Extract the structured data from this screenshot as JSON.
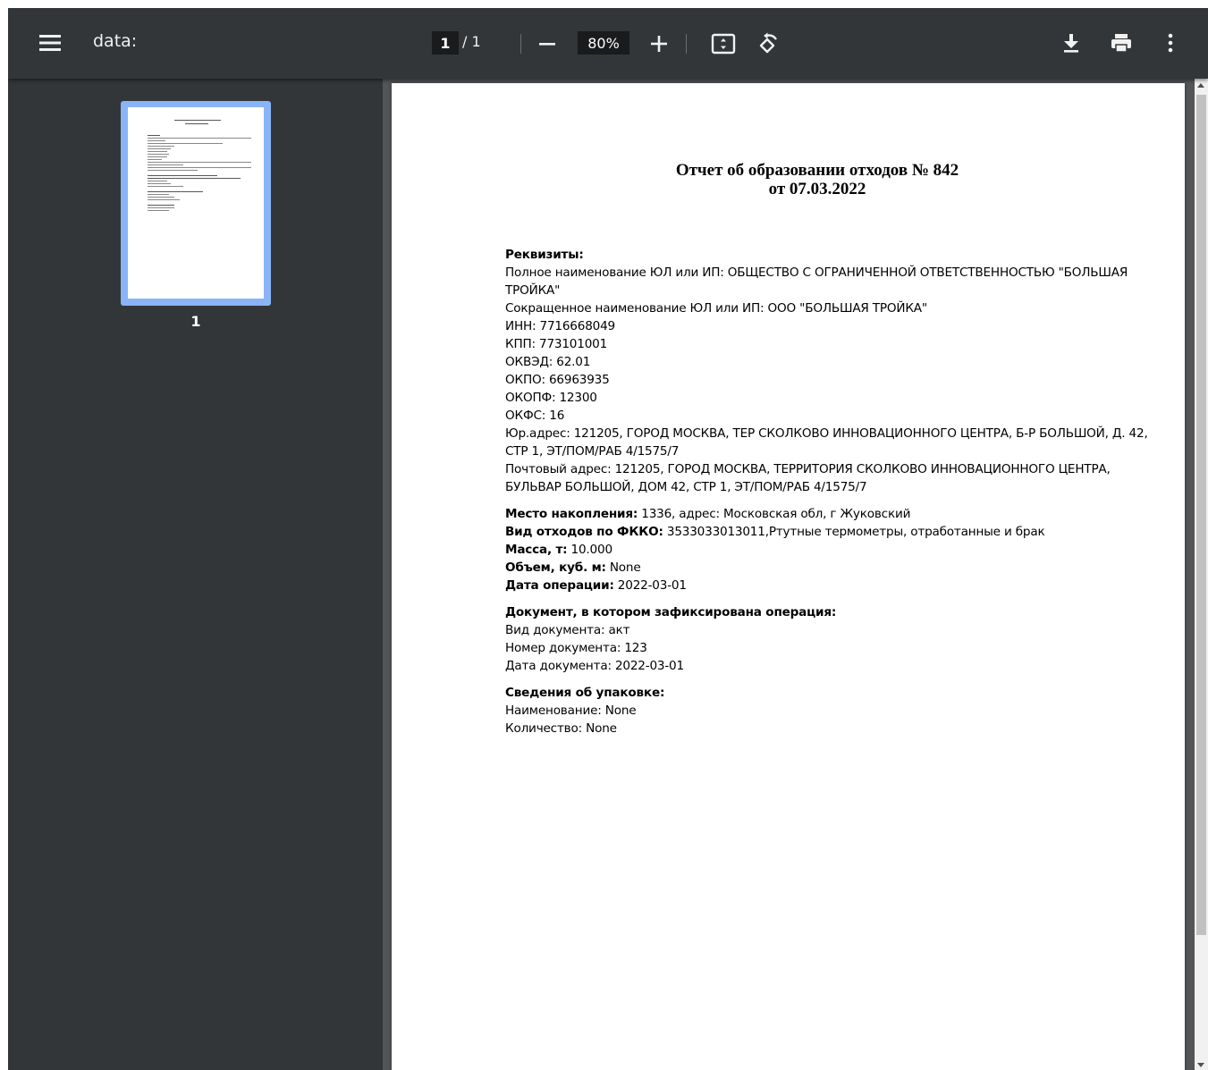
{
  "toolbar": {
    "title": "data:",
    "current_page": "1",
    "page_separator": "/",
    "total_pages": "1",
    "zoom": "80%",
    "icons": {
      "menu": "menu-icon",
      "zoom_out": "minus-icon",
      "zoom_in": "plus-icon",
      "fit": "fit-to-page-icon",
      "rotate": "rotate-icon",
      "download": "download-icon",
      "print": "print-icon",
      "more": "more-vert-icon"
    }
  },
  "sidebar": {
    "thumbnails": [
      {
        "label": "1",
        "selected": true
      }
    ],
    "selected_color": "#8ab4f8"
  },
  "document": {
    "title_line1": "Отчет об образовании отходов № 842",
    "title_line2": "от 07.03.2022",
    "requisites": {
      "heading": "Реквизиты:",
      "full_name": "Полное наименование ЮЛ или ИП: ОБЩЕСТВО С ОГРАНИЧЕННОЙ ОТВЕТСТВЕННОСТЬЮ \"БОЛЬШАЯ ТРОЙКА\"",
      "short_name": "Сокращенное наименование ЮЛ или ИП: ООО \"БОЛЬШАЯ ТРОЙКА\"",
      "inn": "ИНН: 7716668049",
      "kpp": "КПП: 773101001",
      "okved": "ОКВЭД: 62.01",
      "okpo": "ОКПО: 66963935",
      "okopf": "ОКОПФ: 12300",
      "okfs": "ОКФС: 16",
      "legal_address": "Юр.адрес: 121205, ГОРОД МОСКВА, ТЕР СКОЛКОВО ИННОВАЦИОННОГО ЦЕНТРА, Б-Р БОЛЬШОЙ, Д. 42, СТР 1, ЭТ/ПОМ/РАБ 4/1575/7",
      "postal_address": "Почтовый адрес: 121205, ГОРОД МОСКВА, ТЕРРИТОРИЯ СКОЛКОВО ИННОВАЦИОННОГО ЦЕНТРА, БУЛЬВАР БОЛЬШОЙ, ДОМ 42, СТР 1, ЭТ/ПОМ/РАБ 4/1575/7"
    },
    "waste": {
      "storage_label": "Место накопления:",
      "storage_value": " 1336, адрес: Московская обл, г Жуковский",
      "fkko_label": "Вид отходов по ФККО:",
      "fkko_value": " 3533033013011,Ртутные термометры, отработанные и брак",
      "mass_label": "Масса, т:",
      "mass_value": " 10.000",
      "volume_label": "Объем, куб. м:",
      "volume_value": " None",
      "date_label": "Дата операции:",
      "date_value": " 2022-03-01"
    },
    "operation_doc": {
      "heading": "Документ, в котором зафиксирована операция:",
      "type": "Вид документа: акт",
      "number": "Номер документа: 123",
      "date": "Дата документа: 2022-03-01"
    },
    "packaging": {
      "heading": "Сведения об упаковке:",
      "name": "Наименование: None",
      "quantity": "Количество: None"
    }
  }
}
